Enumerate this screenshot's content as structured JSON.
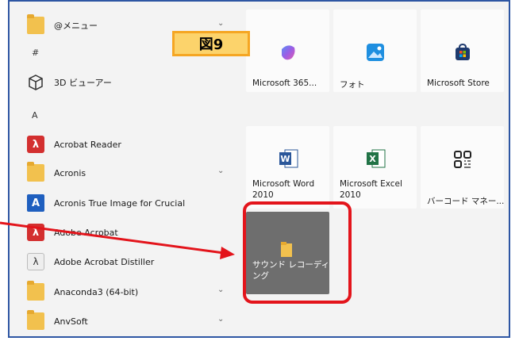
{
  "app_list": {
    "rows": [
      {
        "kind": "folder",
        "label": "@メニュー",
        "chevron": true
      },
      {
        "kind": "header",
        "label": "#"
      },
      {
        "kind": "app",
        "icon": "cube-icon",
        "label": "3D ビューアー"
      },
      {
        "kind": "header",
        "label": "A"
      },
      {
        "kind": "app",
        "icon": "acrobat-reader-icon",
        "label": "Acrobat Reader"
      },
      {
        "kind": "folder",
        "label": "Acronis",
        "chevron": true
      },
      {
        "kind": "app",
        "icon": "acronis-icon",
        "label": "Acronis True Image for Crucial"
      },
      {
        "kind": "app",
        "icon": "adobe-acrobat-icon",
        "label": "Adobe Acrobat"
      },
      {
        "kind": "app",
        "icon": "acrobat-distiller-icon",
        "label": "Adobe Acrobat Distiller"
      },
      {
        "kind": "folder",
        "label": "Anaconda3 (64-bit)",
        "chevron": true
      },
      {
        "kind": "folder",
        "label": "AnvSoft",
        "chevron": true
      }
    ]
  },
  "tiles": {
    "m365": "Microsoft 365...",
    "photos": "フォト",
    "store": "Microsoft Store",
    "word": "Microsoft Word\n2010",
    "excel": "Microsoft Excel\n2010",
    "barcode": "バーコード マネー...",
    "sound": "サウンド レコーディ\nング"
  },
  "callout": "図9",
  "colors": {
    "frame_border": "#2e56a3",
    "highlight": "#e3141b",
    "callout_fill": "#fcd36b",
    "callout_border": "#f5a623"
  }
}
